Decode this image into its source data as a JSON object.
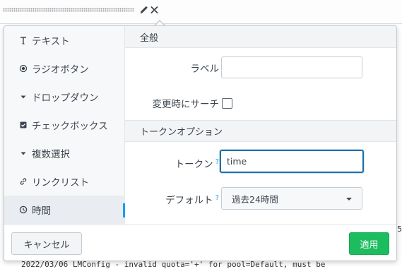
{
  "sidebar": {
    "items": [
      {
        "label": "テキスト",
        "icon": "text-T-icon"
      },
      {
        "label": "ラジオボタン",
        "icon": "radio-icon"
      },
      {
        "label": "ドロップダウン",
        "icon": "dropdown-caret-icon"
      },
      {
        "label": "チェックボックス",
        "icon": "checkbox-icon"
      },
      {
        "label": "複数選択",
        "icon": "multiselect-caret-icon"
      },
      {
        "label": "リンクリスト",
        "icon": "link-icon"
      },
      {
        "label": "時間",
        "icon": "clock-icon",
        "active": true
      }
    ]
  },
  "general": {
    "heading": "全般",
    "label_field": {
      "label": "ラベル",
      "value": ""
    },
    "search_on_change": {
      "label": "変更時にサーチ",
      "checked": false
    }
  },
  "token_options": {
    "heading": "トークンオプション",
    "token": {
      "label": "トークン",
      "help": "?",
      "value": "time"
    },
    "default": {
      "label": "デフォルト",
      "help": "?",
      "value": "過去24時間"
    }
  },
  "footer": {
    "cancel_label": "キャンセル",
    "apply_label": "適用"
  },
  "background": {
    "log_line": "2022/03/06   LMConfig - invalid quota='+' for pool=Default, must be",
    "fragment": "5"
  },
  "colors": {
    "accent": "#1a9cf0",
    "apply_green": "#1cbd5e",
    "focus_border": "#1f6fa8"
  }
}
